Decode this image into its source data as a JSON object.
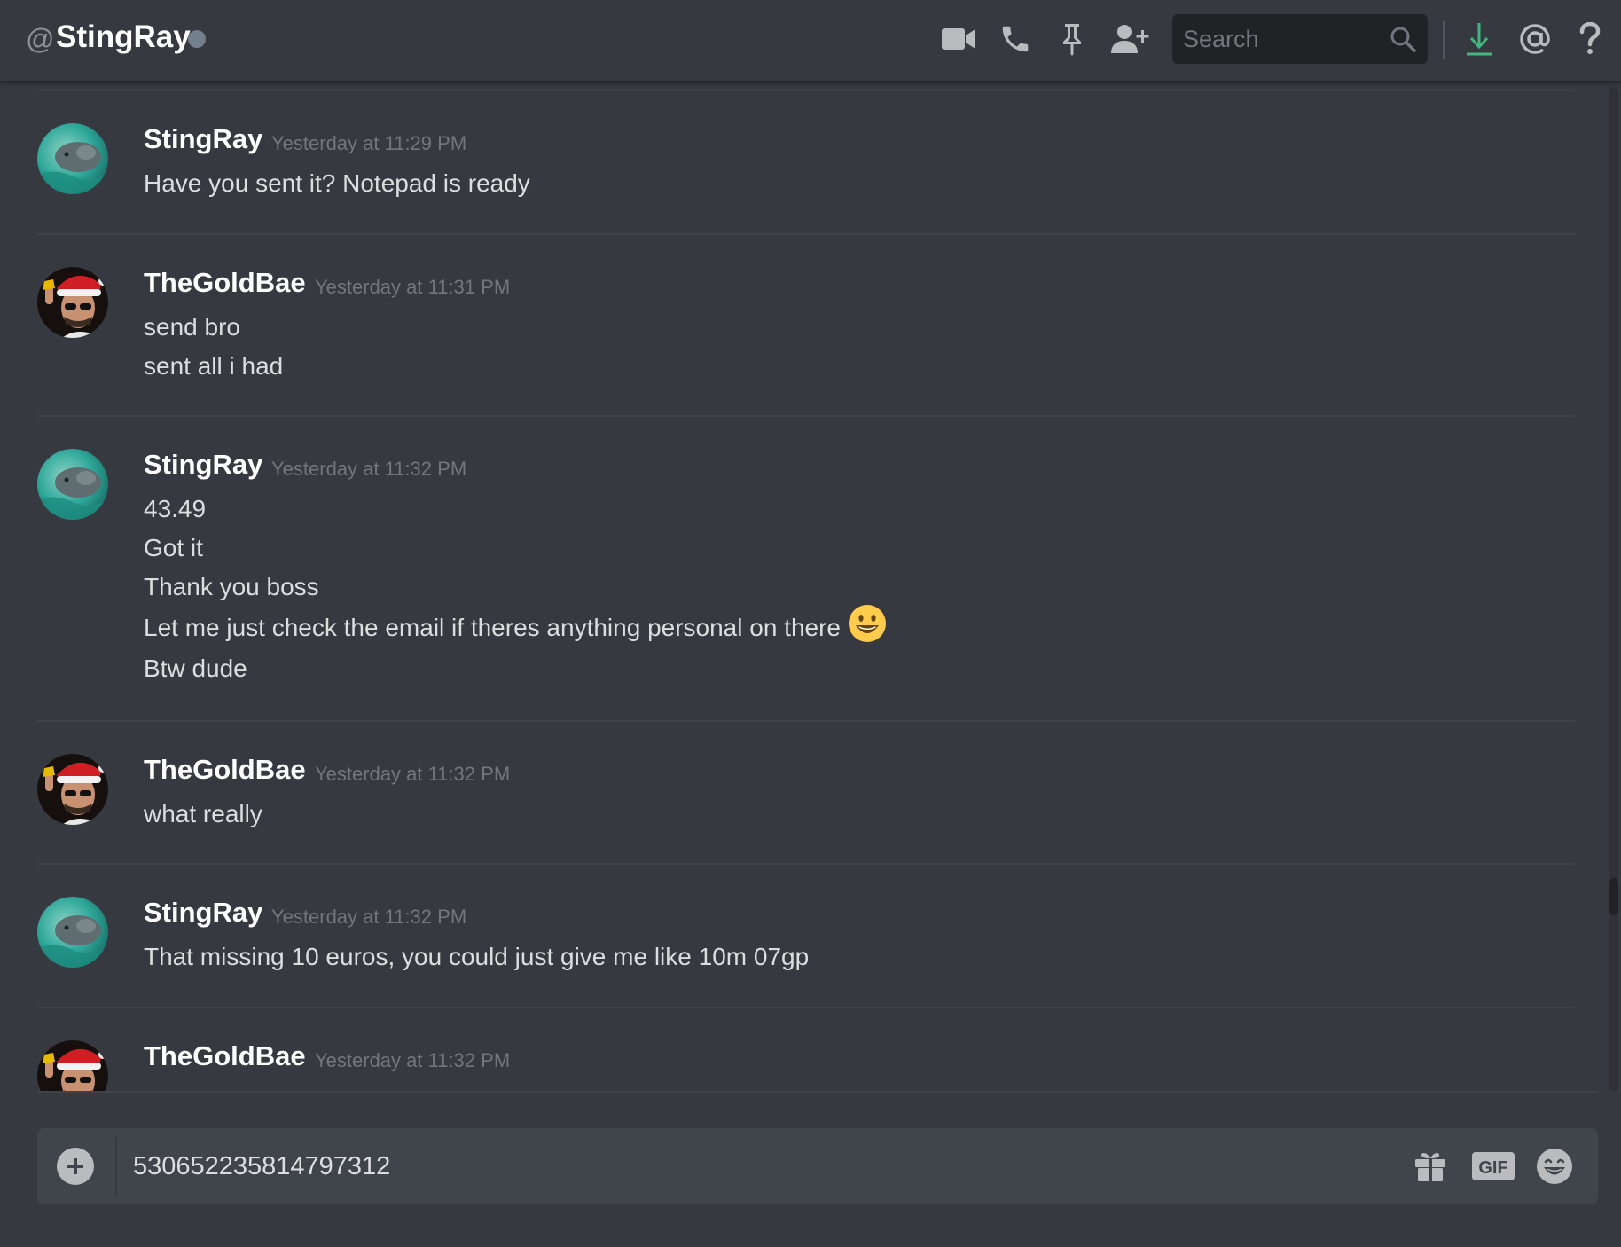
{
  "header": {
    "at_symbol": "@",
    "channel_name": "StingRay",
    "status": "offline",
    "search_placeholder": "Search",
    "icons": [
      "video-call-icon",
      "voice-call-icon",
      "pin-icon",
      "add-friend-icon",
      "search-icon",
      "download-icon",
      "mention-icon",
      "help-icon"
    ]
  },
  "messages": [
    {
      "author": "StingRay",
      "timestamp": "Yesterday at 11:29 PM",
      "avatar": "stingray-avatar",
      "lines": [
        "Have you sent it? Notepad is ready"
      ]
    },
    {
      "author": "TheGoldBae",
      "timestamp": "Yesterday at 11:31 PM",
      "avatar": "goldbae-avatar",
      "lines": [
        "send bro",
        "sent all i had"
      ]
    },
    {
      "author": "StingRay",
      "timestamp": "Yesterday at 11:32 PM",
      "avatar": "stingray-avatar",
      "lines": [
        "43.49",
        "Got it",
        "Thank you boss",
        "Let me just check the email if theres anything personal on there",
        "Btw dude"
      ],
      "emoji_line_index": 3,
      "emoji": "smiley-emoji"
    },
    {
      "author": "TheGoldBae",
      "timestamp": "Yesterday at 11:32 PM",
      "avatar": "goldbae-avatar",
      "lines": [
        "what really"
      ]
    },
    {
      "author": "StingRay",
      "timestamp": "Yesterday at 11:32 PM",
      "avatar": "stingray-avatar",
      "lines": [
        "That missing 10 euros, you could just give me like 10m 07gp"
      ]
    },
    {
      "author": "TheGoldBae",
      "timestamp": "Yesterday at 11:32 PM",
      "avatar": "goldbae-avatar",
      "lines": []
    }
  ],
  "composer": {
    "value": "530652235814797312",
    "icons": [
      "upload-plus-icon",
      "gift-icon",
      "gif-icon",
      "emoji-picker-icon"
    ],
    "gif_label": "GIF"
  },
  "colors": {
    "background": "#36393f",
    "input_background": "#40444b",
    "search_background": "#202225",
    "download_accent": "#43b581",
    "status_offline": "#747f8d",
    "emoji_yellow": "#ffcc4d"
  }
}
